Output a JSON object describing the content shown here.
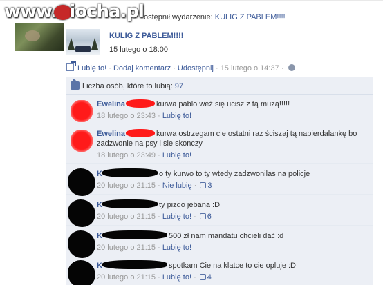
{
  "watermark": {
    "text": "wiocha.pl"
  },
  "header": {
    "prefix": "ostępnił wydarzenie: ",
    "event_link": "KULIG Z PABLEM!!!!"
  },
  "event": {
    "title": "KULIG Z PABLEM!!!!",
    "date": "15 lutego o 18:00"
  },
  "actions": {
    "like": "Lubię to!",
    "comment": "Dodaj komentarz",
    "share": "Udostępnij",
    "dot": " · ",
    "timestamp": "15 lutego o 14:37"
  },
  "likes": {
    "label": "Liczba osób, które to lubią:",
    "count": "97"
  },
  "comments": [
    {
      "author": "Ewelina",
      "text": "kurwa pablo weź się ucisz z tą muzą!!!!!",
      "time": "18 lutego o 23:43",
      "action": "Lubię to!",
      "likes": ""
    },
    {
      "author": "Ewelina",
      "text": "kurwa ostrzegam cie ostatni raz ściszaj tą napierdalankę bo zadzwonie na psy i sie skonczy",
      "time": "18 lutego o 23:49",
      "action": "Lubię to!",
      "likes": ""
    },
    {
      "author": "K",
      "text": "o ty kurwo to ty wtedy zadzwonilas na policje",
      "time": "20 lutego o 21:15",
      "action": "Nie lubię",
      "likes": "3"
    },
    {
      "author": "K",
      "text": "ty pizdo jebana :D",
      "time": "20 lutego o 21:15",
      "action": "Lubię to!",
      "likes": "6"
    },
    {
      "author": "K",
      "text": "500 zł nam mandatu chcieli dać :d",
      "time": "20 lutego o 21:15",
      "action": "Lubię to!",
      "likes": ""
    },
    {
      "author": "K",
      "text": "spotkam Cie na klatce to cie opluje :D",
      "time": "20 lutego o 21:15",
      "action": "Lubię to!",
      "likes": "4"
    }
  ],
  "colors": {
    "link": "#3b5998",
    "comment_bg": "#eceff5",
    "meta": "#999999",
    "redaction_red": "#ff1a1a",
    "redaction_black": "#050505"
  }
}
